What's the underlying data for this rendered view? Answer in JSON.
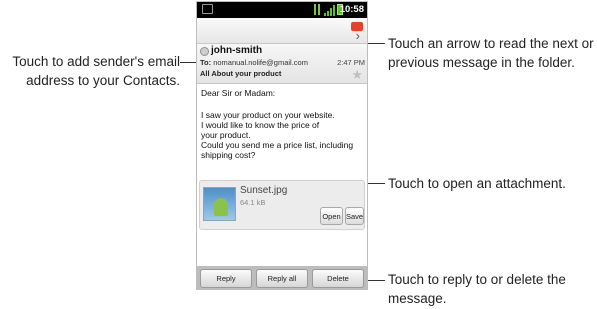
{
  "callouts": {
    "add_contact": [
      "Touch to add sender's email",
      "address to your Contacts."
    ],
    "arrow": [
      "Touch an arrow to read the next or",
      "previous message in the folder."
    ],
    "attachment": "Touch to open an attachment.",
    "reply": [
      "Touch to reply to or delete the",
      "message."
    ]
  },
  "status_bar": {
    "time": "10:58"
  },
  "toolbar": {
    "next_arrow": "›"
  },
  "message": {
    "sender": "john-smith",
    "to_label": "To:",
    "to_address": "nomanual.nolife@gmail.com",
    "time": "2:47 PM",
    "subject": "All About your product",
    "body_lines": [
      "Dear Sir or Madam:",
      "I saw your product on your website.",
      "I would like to know the price of",
      "your product.",
      "Could you send me a price list, including",
      "shipping cost?"
    ]
  },
  "attachment": {
    "name": "Sunset.jpg",
    "size": "64.1 kB",
    "open_label": "Open",
    "save_label": "Save"
  },
  "actions": {
    "reply": "Reply",
    "reply_all": "Reply all",
    "delete": "Delete"
  }
}
